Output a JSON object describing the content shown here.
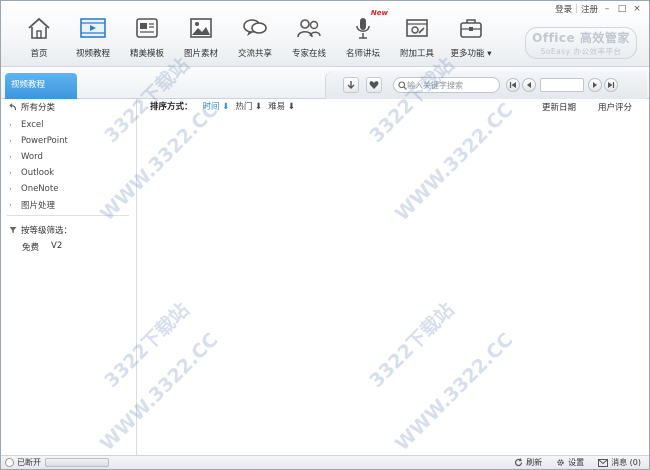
{
  "window": {
    "login": "登录",
    "register": "注册",
    "minimize_glyph": "–",
    "maximize_glyph": "□",
    "close_glyph": "×"
  },
  "nav": {
    "items": [
      {
        "label": "首页",
        "icon": "home-icon"
      },
      {
        "label": "视频教程",
        "icon": "film-icon"
      },
      {
        "label": "精美模板",
        "icon": "template-icon"
      },
      {
        "label": "图片素材",
        "icon": "picture-icon"
      },
      {
        "label": "交流共享",
        "icon": "chat-icon"
      },
      {
        "label": "专家在线",
        "icon": "experts-icon"
      },
      {
        "label": "名师讲坛",
        "icon": "microphone-icon",
        "badge": "New"
      },
      {
        "label": "附加工具",
        "icon": "tools-icon"
      },
      {
        "label": "更多功能 ▾",
        "icon": "briefcase-icon"
      }
    ]
  },
  "brand": {
    "line1": "Office 高效管家",
    "line2": "SoEasy 办公效率平台"
  },
  "tabbar": {
    "active_tab": "视频教程",
    "search_placeholder": "输入关键字搜索"
  },
  "sidebar": {
    "all_label": "所有分类",
    "items": [
      "Excel",
      "PowerPoint",
      "Word",
      "Outlook",
      "OneNote",
      "图片处理"
    ],
    "filter_title": "按等级筛选：",
    "filter_options": [
      "免费",
      "V2"
    ]
  },
  "content": {
    "sort_label": "排序方式：",
    "sort_options": [
      {
        "label": "时间 ⬇",
        "active": true
      },
      {
        "label": "热门 ⬇",
        "active": false
      },
      {
        "label": "难易 ⬇",
        "active": false
      }
    ],
    "col_date": "更新日期",
    "col_rating": "用户评分"
  },
  "watermark": {
    "text_cn": "3322下载站",
    "text_url": "WWW.3322.CC"
  },
  "status": {
    "connection": "已断开",
    "refresh": "刷新",
    "settings": "设置",
    "messages": "消息 (0)"
  },
  "colors": {
    "accent": "#3d95dc",
    "active_sort": "#3b8fd6"
  }
}
